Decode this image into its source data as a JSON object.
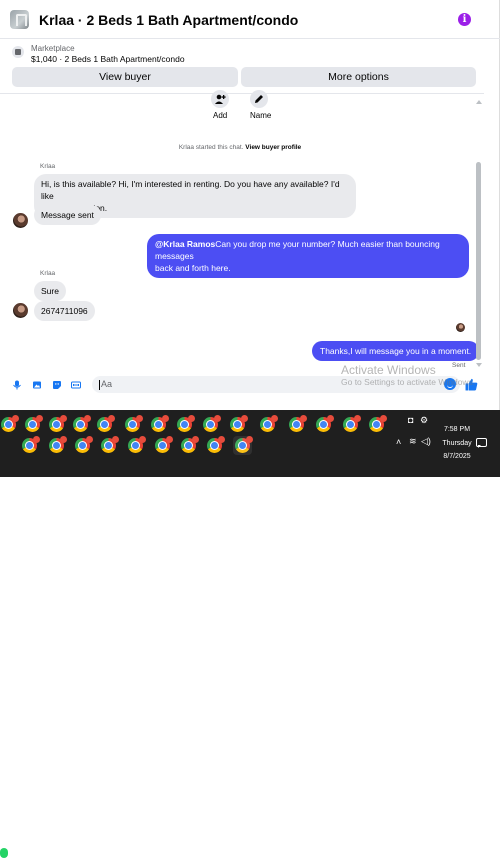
{
  "header": {
    "title": "Krlaa · 2 Beds 1 Bath Apartment/condo",
    "info_icon": "info-icon"
  },
  "marketplace": {
    "label": "Marketplace",
    "price_title": "$1,040 · 2 Beds 1 Bath Apartment/condo",
    "view_buyer": "View buyer",
    "more_options": "More options"
  },
  "actions": {
    "add_label": "Add",
    "name_label": "Name"
  },
  "system_msg": {
    "text": "Krlaa started this chat. ",
    "link": "View buyer profile"
  },
  "messages": {
    "sender1": "Krlaa",
    "m1_line1": "Hi, is this available? Hi, I'm interested in renting. Do you have any available? I'd like",
    "m1_line2": "more information.",
    "m2": "Message sent",
    "out1_mention": "@Krlaa Ramos",
    "out1_line1": "Can you drop me your number? Much easier than bouncing messages",
    "out1_line2": "back and forth here.",
    "sender2": "Krlaa",
    "m3": "Sure",
    "m4": "2674711096",
    "out2": "Thanks,I will message you in a moment.",
    "status": "Sent"
  },
  "composer": {
    "placeholder": "Aa",
    "icons": [
      "microphone-icon",
      "photo-icon",
      "sticker-icon",
      "gif-icon",
      "emoji-icon",
      "like-icon"
    ]
  },
  "watermark": {
    "line1": "Activate Windows",
    "line2": "Go to Settings to activate Windows."
  },
  "taskbar": {
    "time": "7:58 PM",
    "day": "Thursday",
    "date": "8/7/2025"
  },
  "colors": {
    "outgoing_bubble": "#4c4ef3",
    "incoming_bubble": "#e9eaed",
    "accent": "#1877f2",
    "info": "#9b1fe8"
  }
}
